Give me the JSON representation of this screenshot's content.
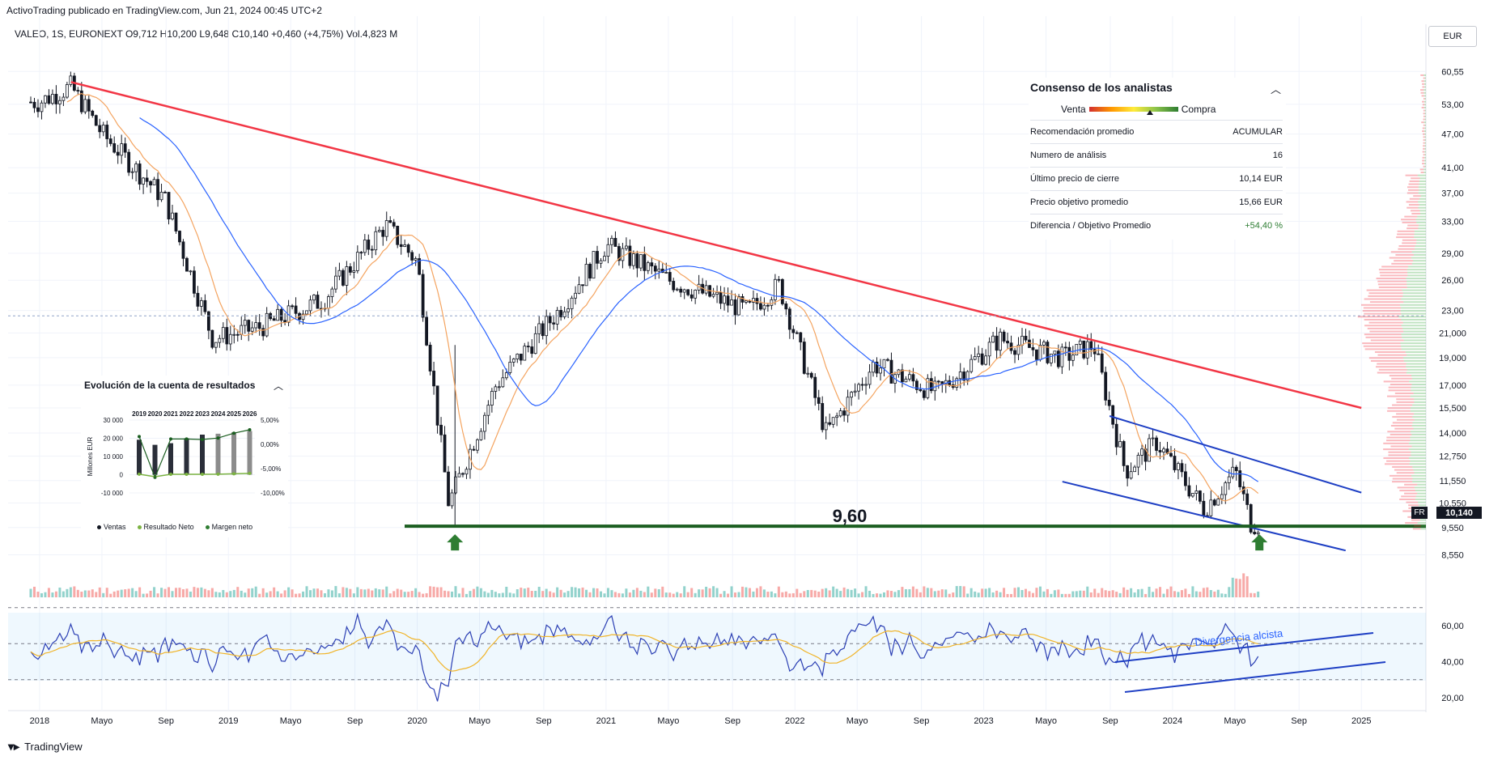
{
  "header": {
    "published": "ActivoTrading publicado en TradingView.com, Jun 21, 2024 00:45 UTC+2",
    "symbol": "VALEO, 1S, EURONEXT",
    "open": "O9,712",
    "high": "H10,200",
    "low": "L9,648",
    "close": "C10,140",
    "change": "+0,460 (+4,75%)",
    "volume": "Vol.4,823 M",
    "currency": "EUR"
  },
  "footer": {
    "brand": "TradingView"
  },
  "price_labels": {
    "current": "10,140",
    "flag": "FR"
  },
  "annotations": {
    "support_value": "9,60",
    "divergence": "Divergencia alcista"
  },
  "analyst": {
    "title": "Consenso de los analistas",
    "sell": "Venta",
    "buy": "Compra",
    "rows": [
      {
        "label": "Recomendación promedio",
        "value": "ACUMULAR"
      },
      {
        "label": "Numero de análisis",
        "value": "16"
      },
      {
        "label": "Último precio de cierre",
        "value": "10,14 EUR"
      },
      {
        "label": "Precio objetivo promedio",
        "value": "15,66 EUR"
      },
      {
        "label": "Diferencia / Objetivo Promedio",
        "value": "+54,40 %"
      }
    ],
    "sentiment_score": 0.68
  },
  "financials": {
    "title": "Evolución de la cuenta de resultados",
    "years": [
      "2019",
      "2020",
      "2021",
      "2022",
      "2023",
      "2024",
      "2025",
      "2026"
    ],
    "y_left": [
      "30 000",
      "20 000",
      "10 000",
      "0",
      "-10 000"
    ],
    "y_right": [
      "5,00%",
      "0,00%",
      "-5,00%",
      "-10,00%"
    ],
    "y_axis_label": "Millones EUR",
    "legend": [
      "Ventas",
      "Resultado Neto",
      "Margen neto"
    ],
    "ventas": [
      19200,
      16400,
      17300,
      20000,
      22000,
      22500,
      23300,
      24000
    ],
    "resultado_neto": [
      300,
      -1100,
      200,
      200,
      200,
      300,
      500,
      700
    ],
    "margen_neto": [
      1.6,
      -6.8,
      1.1,
      1.1,
      1.0,
      1.3,
      2.3,
      3.0
    ]
  },
  "chart_data": {
    "type": "candlestick",
    "symbol": "VALEO",
    "interval": "1S",
    "exchange": "EURONEXT",
    "scale": "log",
    "price_axis": [
      "60,55",
      "53,00",
      "47,00",
      "41,00",
      "37,00",
      "33,00",
      "29,00",
      "26,00",
      "23,00",
      "21,000",
      "19,000",
      "17,000",
      "15,500",
      "14,000",
      "12,750",
      "11,550",
      "10,550",
      "9,550",
      "8,550"
    ],
    "time_axis": [
      "2018",
      "Mayo",
      "Sep",
      "2019",
      "Mayo",
      "Sep",
      "2020",
      "Mayo",
      "Sep",
      "2021",
      "Mayo",
      "Sep",
      "2022",
      "Mayo",
      "Sep",
      "2023",
      "Mayo",
      "Sep",
      "2024",
      "Mayo",
      "Sep",
      "2025"
    ],
    "rsi_axis": [
      "60,00",
      "40,00",
      "20,00"
    ],
    "rsi_levels": [
      70,
      50,
      30
    ],
    "ylim": [
      8.1,
      66
    ],
    "key_points": [
      {
        "date": "2018-01",
        "price": 53.5
      },
      {
        "date": "2018-03",
        "price": 57.0
      },
      {
        "date": "2018-05",
        "price": 47.0
      },
      {
        "date": "2018-09",
        "price": 36.0
      },
      {
        "date": "2018-12",
        "price": 20.5
      },
      {
        "date": "2019-03",
        "price": 21.5
      },
      {
        "date": "2019-07",
        "price": 24.0
      },
      {
        "date": "2019-11",
        "price": 32.5
      },
      {
        "date": "2020-01",
        "price": 28.0
      },
      {
        "date": "2020-03",
        "price": 10.5
      },
      {
        "date": "2020-06",
        "price": 17.0
      },
      {
        "date": "2020-10",
        "price": 23.0
      },
      {
        "date": "2021-01",
        "price": 30.0
      },
      {
        "date": "2021-05",
        "price": 26.0
      },
      {
        "date": "2021-10",
        "price": 23.0
      },
      {
        "date": "2021-12",
        "price": 25.5
      },
      {
        "date": "2022-03",
        "price": 14.0
      },
      {
        "date": "2022-06",
        "price": 18.5
      },
      {
        "date": "2022-10",
        "price": 16.5
      },
      {
        "date": "2023-02",
        "price": 20.5
      },
      {
        "date": "2023-06",
        "price": 19.0
      },
      {
        "date": "2023-08",
        "price": 20.0
      },
      {
        "date": "2023-10",
        "price": 12.0
      },
      {
        "date": "2023-12",
        "price": 13.5
      },
      {
        "date": "2024-03",
        "price": 10.3
      },
      {
        "date": "2024-05",
        "price": 12.0
      },
      {
        "date": "2024-06",
        "price": 9.7
      }
    ],
    "support_level": 9.6,
    "trendline": {
      "from": {
        "date": "2018-03",
        "price": 58.0
      },
      "to": {
        "date": "2025-01",
        "price": 15.5
      }
    },
    "channel_upper": {
      "from": {
        "date": "2023-09",
        "price": 15.0
      },
      "to": {
        "date": "2025-01",
        "price": 11.0
      }
    },
    "channel_lower": {
      "from": {
        "date": "2023-06",
        "price": 11.5
      },
      "to": {
        "date": "2024-12",
        "price": 8.7
      }
    }
  }
}
